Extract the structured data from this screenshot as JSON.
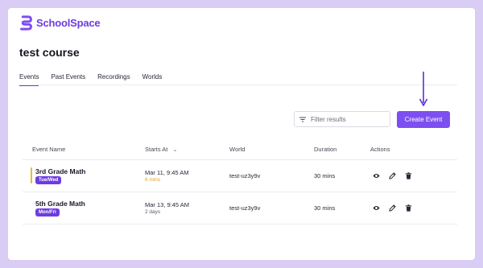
{
  "brand": {
    "name": "SchoolSpace",
    "color": "#6d3ce0"
  },
  "course": {
    "title": "test course"
  },
  "tabs": [
    {
      "label": "Events",
      "active": true
    },
    {
      "label": "Past Events",
      "active": false
    },
    {
      "label": "Recordings",
      "active": false
    },
    {
      "label": "Worlds",
      "active": false
    }
  ],
  "toolbar": {
    "filter_placeholder": "Filter results",
    "filter_icon": "filter-icon",
    "create_label": "Create Event"
  },
  "table": {
    "headers": {
      "event_name": "Event Name",
      "starts_at": "Starts At",
      "starts_at_sort_icon": "chevron-down-icon",
      "world": "World",
      "duration": "Duration",
      "actions": "Actions"
    },
    "rows": [
      {
        "name": "3rd Grade Math",
        "days": "Tue/Wed",
        "starts": "Mar 11, 9:45 AM",
        "relative": "6 mins",
        "world": "test-uz3y9v",
        "duration": "30 mins",
        "highlight": true
      },
      {
        "name": "5th Grade Math",
        "days": "Mon/Fri",
        "starts": "Mar 13, 9:45 AM",
        "relative": "2 days",
        "world": "test-uz3y9v",
        "duration": "30 mins",
        "highlight": false
      }
    ],
    "action_icons": [
      "eye-icon",
      "pencil-icon",
      "trash-icon"
    ]
  },
  "colors": {
    "accent": "#7d4ff0",
    "soon": "#f2b632",
    "background": "#d9ccf5"
  }
}
